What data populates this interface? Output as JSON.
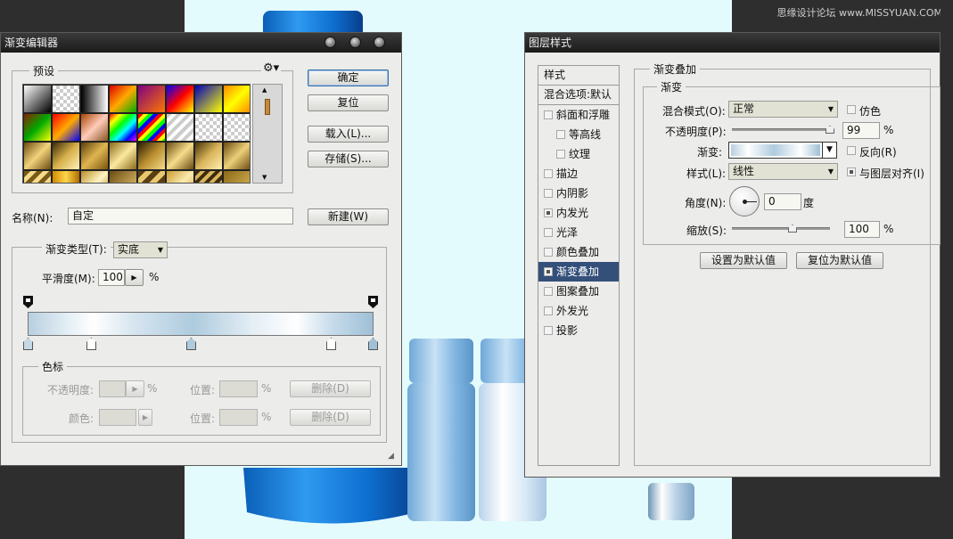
{
  "watermark": "思缘设计论坛 www.MISSYUAN.COM",
  "gradient_editor": {
    "title": "渐变编辑器",
    "presets_label": "预设",
    "buttons": {
      "ok": "确定",
      "reset": "复位",
      "load": "载入(L)...",
      "save": "存储(S)...",
      "new": "新建(W)"
    },
    "name_label": "名称(N):",
    "name_value": "自定",
    "gradient_type_label": "渐变类型(T):",
    "gradient_type_value": "实底",
    "smoothness_label": "平滑度(M):",
    "smoothness_value": "100",
    "percent": "%",
    "color_stops": {
      "legend": "色标",
      "opacity_label": "不透明度:",
      "color_label": "颜色:",
      "location_label": "位置:",
      "delete_label": "删除(D)"
    }
  },
  "layer_style": {
    "title": "图层样式",
    "sidebar": {
      "header": "样式",
      "blend_options": "混合选项:默认",
      "items": [
        {
          "label": "斜面和浮雕",
          "checked": false,
          "sub": false
        },
        {
          "label": "等高线",
          "checked": false,
          "sub": true
        },
        {
          "label": "纹理",
          "checked": false,
          "sub": true
        },
        {
          "label": "描边",
          "checked": false,
          "sub": false
        },
        {
          "label": "内阴影",
          "checked": false,
          "sub": false
        },
        {
          "label": "内发光",
          "checked": true,
          "sub": false
        },
        {
          "label": "光泽",
          "checked": false,
          "sub": false
        },
        {
          "label": "颜色叠加",
          "checked": false,
          "sub": false
        },
        {
          "label": "渐变叠加",
          "checked": true,
          "sub": false,
          "selected": true
        },
        {
          "label": "图案叠加",
          "checked": false,
          "sub": false
        },
        {
          "label": "外发光",
          "checked": false,
          "sub": false
        },
        {
          "label": "投影",
          "checked": false,
          "sub": false
        }
      ]
    },
    "panel": {
      "section_title": "渐变叠加",
      "group_title": "渐变",
      "blend_mode_label": "混合模式(O):",
      "blend_mode_value": "正常",
      "dither_label": "仿色",
      "opacity_label": "不透明度(P):",
      "opacity_value": "99",
      "percent": "%",
      "gradient_label": "渐变:",
      "reverse_label": "反向(R)",
      "style_label": "样式(L):",
      "style_value": "线性",
      "align_label": "与图层对齐(I)",
      "angle_label": "角度(N):",
      "angle_value": "0",
      "degree_unit": "度",
      "scale_label": "缩放(S):",
      "scale_value": "100",
      "set_default": "设置为默认值",
      "reset_default": "复位为默认值"
    }
  },
  "colors": {
    "canvas_bg": "#e4fbfd",
    "selected_row": "#34507a",
    "title_bar": "#1e1e1e"
  }
}
